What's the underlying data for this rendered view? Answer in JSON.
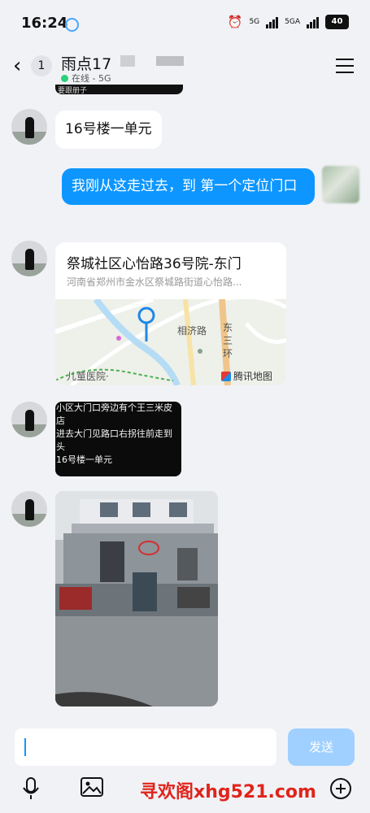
{
  "status_bar": {
    "time": "16:24",
    "network_1": "5G",
    "network_2": "5GA",
    "battery": "40"
  },
  "header": {
    "back_count": "1",
    "contact_name": "雨点17",
    "online_status": "在线 - 5G"
  },
  "top_sliver_text": "要跟册子",
  "messages": {
    "m1": "16号楼一单元",
    "m2": "我刚从这走过去，到 第一个定位门口",
    "location": {
      "title": "祭城社区心怡路36号院-东门",
      "address": "河南省郑州市金水区祭城路街道心怡路...",
      "map_label_road": "相济路",
      "map_label_ring_1": "东",
      "map_label_ring_2": "三",
      "map_label_ring_3": "环",
      "map_label_hospital": "儿童医院·",
      "map_brand": "腾讯地图"
    },
    "dark_lines": [
      "小区大门口旁边有个王三米皮",
      "店",
      "进去大门见路口右拐往前走到",
      "头",
      "16号楼一单元"
    ]
  },
  "input_bar": {
    "send_label": "发送"
  },
  "watermark": "寻欢阁xhg521.com",
  "colors": {
    "accent_blue": "#0d96ff",
    "send_disabled": "#9fd0ff",
    "background": "#f1f2f6",
    "online_green": "#2bd178"
  }
}
